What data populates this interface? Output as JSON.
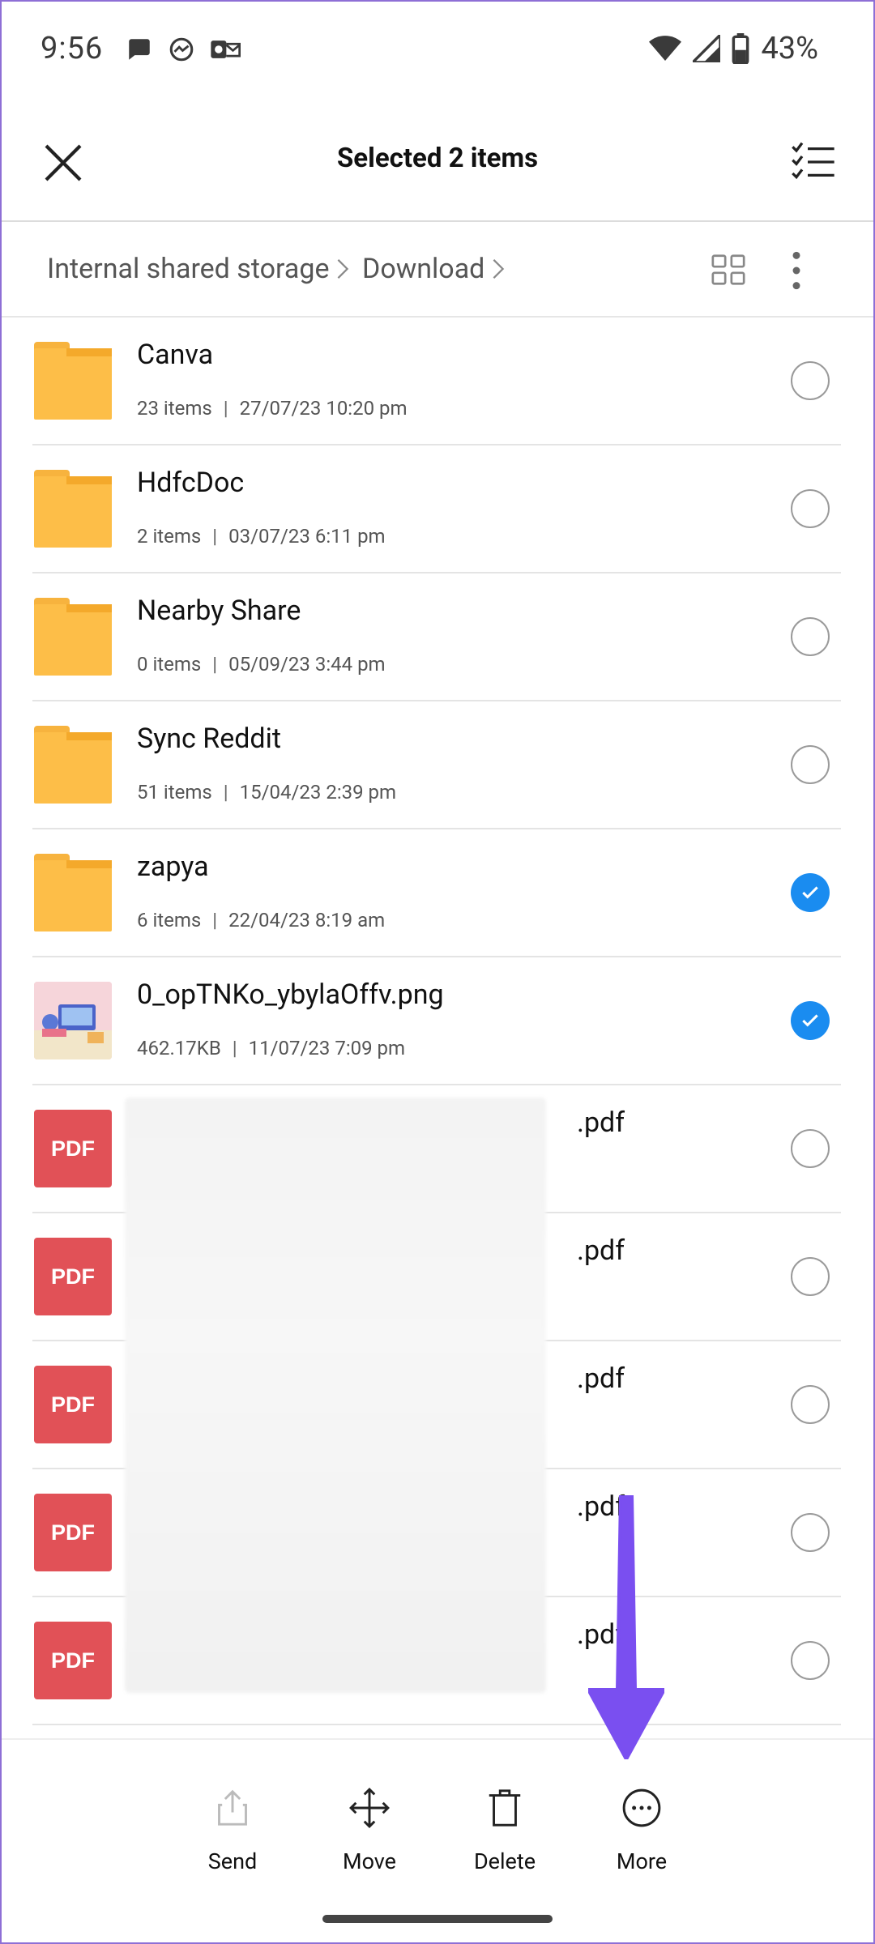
{
  "status_bar": {
    "time": "9:56",
    "battery": "43%"
  },
  "app_bar": {
    "title": "Selected 2 items"
  },
  "breadcrumb": {
    "root": "Internal shared storage",
    "current": "Download"
  },
  "items": [
    {
      "type": "folder",
      "name": "Canva",
      "count": "23 items",
      "date": "27/07/23 10:20 pm",
      "selected": false
    },
    {
      "type": "folder",
      "name": "HdfcDoc",
      "count": "2 items",
      "date": "03/07/23 6:11 pm",
      "selected": false
    },
    {
      "type": "folder",
      "name": "Nearby Share",
      "count": "0 items",
      "date": "05/09/23 3:44 pm",
      "selected": false
    },
    {
      "type": "folder",
      "name": "Sync Reddit",
      "count": "51 items",
      "date": "15/04/23 2:39 pm",
      "selected": false
    },
    {
      "type": "folder",
      "name": "zapya",
      "count": "6 items",
      "date": "22/04/23 8:19 am",
      "selected": true
    },
    {
      "type": "image",
      "name": "0_opTNKo_ybylaOffv.png",
      "count": "462.17KB",
      "date": "11/07/23 7:09 pm",
      "selected": true
    },
    {
      "type": "pdf",
      "label": "PDF",
      "name": ".pdf",
      "selected": false
    },
    {
      "type": "pdf",
      "label": "PDF",
      "name": ".pdf",
      "selected": false
    },
    {
      "type": "pdf",
      "label": "PDF",
      "name": ".pdf",
      "selected": false
    },
    {
      "type": "pdf",
      "label": "PDF",
      "name": ".pdf",
      "selected": false
    },
    {
      "type": "pdf",
      "label": "PDF",
      "name": ".pdf",
      "selected": false
    }
  ],
  "actions": {
    "send": "Send",
    "move": "Move",
    "delete": "Delete",
    "more": "More"
  },
  "colors": {
    "folder": "#fdbe48",
    "pdf": "#e15157",
    "check": "#1a8cf0",
    "arrow": "#7a4ff0"
  }
}
